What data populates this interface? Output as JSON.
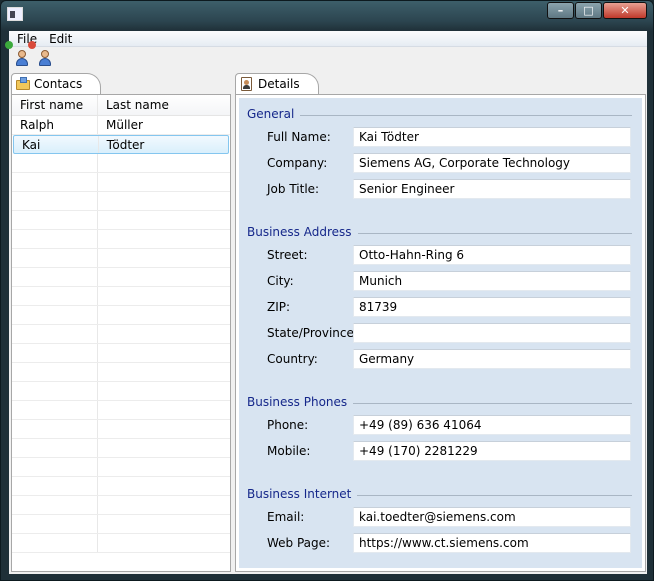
{
  "window": {
    "title": ""
  },
  "menu": {
    "file": "File",
    "edit": "Edit"
  },
  "toolbar": {
    "add_icon": "add-contact-icon",
    "delete_icon": "delete-contact-icon"
  },
  "contacts": {
    "tab_label": "Contacs",
    "columns": [
      "First name",
      "Last name"
    ],
    "rows": [
      {
        "first": "Ralph",
        "last": "Müller"
      },
      {
        "first": "Kai",
        "last": "Tödter"
      }
    ],
    "selected_index": 1
  },
  "details": {
    "tab_label": "Details",
    "general": {
      "title": "General",
      "full_name_label": "Full Name:",
      "full_name": "Kai Tödter",
      "company_label": "Company:",
      "company": "Siemens AG, Corporate Technology",
      "job_title_label": "Job Title:",
      "job_title": "Senior Engineer"
    },
    "address": {
      "title": "Business Address",
      "street_label": "Street:",
      "street": "Otto-Hahn-Ring 6",
      "city_label": "City:",
      "city": "Munich",
      "zip_label": "ZIP:",
      "zip": "81739",
      "state_label": "State/Province:",
      "state": "",
      "country_label": "Country:",
      "country": "Germany"
    },
    "phones": {
      "title": "Business Phones",
      "phone_label": "Phone:",
      "phone": "+49 (89) 636 41064",
      "mobile_label": "Mobile:",
      "mobile": "+49 (170) 2281229"
    },
    "internet": {
      "title": "Business Internet",
      "email_label": "Email:",
      "email": "kai.toedter@siemens.com",
      "web_label": "Web Page:",
      "web": "https://www.ct.siemens.com"
    }
  },
  "colors": {
    "section_title": "#15278a",
    "details_bg": "#d8e4f1",
    "selection": "#d9effc"
  }
}
